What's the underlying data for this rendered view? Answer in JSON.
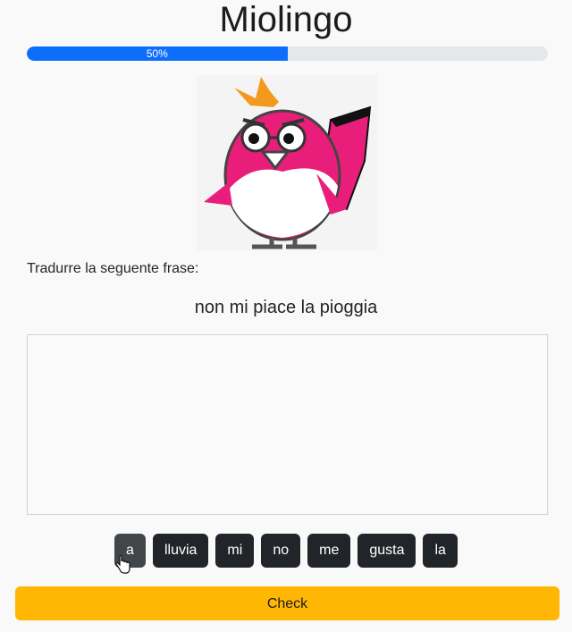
{
  "app": {
    "title": "Miolingo"
  },
  "progress": {
    "label": "50%",
    "value": 0.5,
    "color": "#0d6efd"
  },
  "mascot": {
    "icon": "bird-mascot-icon"
  },
  "exercise": {
    "instruction": "Tradurre la seguente frase:",
    "phrase": "non mi piace la pioggia",
    "answer_value": ""
  },
  "word_bank": [
    "a",
    "lluvia",
    "mi",
    "no",
    "me",
    "gusta",
    "la"
  ],
  "actions": {
    "check_label": "Check",
    "check_color": "#ffb703"
  }
}
